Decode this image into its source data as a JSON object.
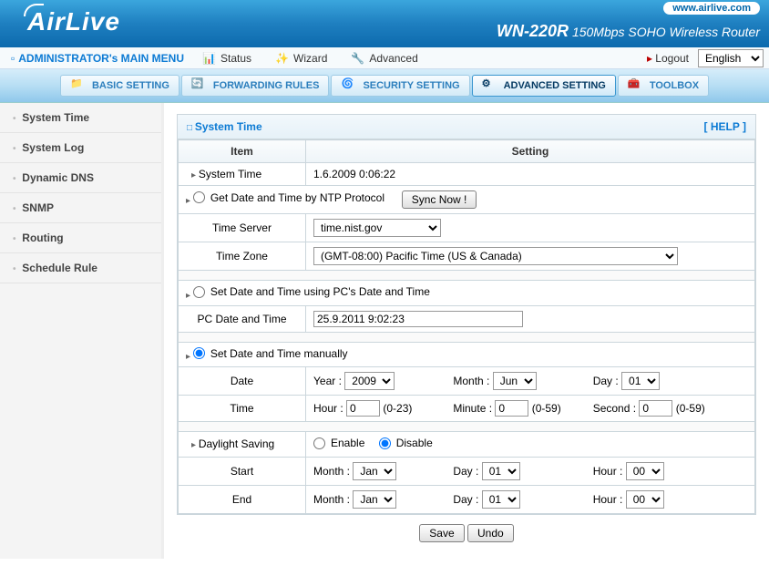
{
  "header": {
    "brand": "AirLive",
    "url_pill": "www.airlive.com",
    "model": "WN-220R",
    "tagline": "150Mbps SOHO Wireless Router"
  },
  "menubar": {
    "admin": "ADMINISTRATOR's MAIN MENU",
    "items": [
      "Status",
      "Wizard",
      "Advanced"
    ],
    "logout": "Logout",
    "language": "English"
  },
  "tabs": [
    "BASIC SETTING",
    "FORWARDING RULES",
    "SECURITY SETTING",
    "ADVANCED SETTING",
    "TOOLBOX"
  ],
  "sidebar": {
    "items": [
      "System Time",
      "System Log",
      "Dynamic DNS",
      "SNMP",
      "Routing",
      "Schedule Rule"
    ]
  },
  "panel": {
    "title": "System Time",
    "help": "[ HELP ]",
    "col_item": "Item",
    "col_setting": "Setting",
    "system_time_lbl": "System Time",
    "system_time_val": "1.6.2009 0:06:22",
    "ntp": {
      "label": "Get Date and Time by NTP Protocol",
      "sync_btn": "Sync Now !",
      "time_server_lbl": "Time Server",
      "time_server_val": "time.nist.gov",
      "time_zone_lbl": "Time Zone",
      "time_zone_val": "(GMT-08:00) Pacific Time (US & Canada)"
    },
    "pc": {
      "label": "Set Date and Time using PC's Date and Time",
      "pc_dt_lbl": "PC Date and Time",
      "pc_dt_val": "25.9.2011 9:02:23"
    },
    "manual": {
      "label": "Set Date and Time manually",
      "date_lbl": "Date",
      "time_lbl": "Time",
      "year_lbl": "Year :",
      "year_val": "2009",
      "month_lbl": "Month :",
      "month_val": "Jun",
      "day_lbl": "Day :",
      "day_val": "01",
      "hour_lbl": "Hour :",
      "hour_val": "0",
      "hour_range": "(0-23)",
      "minute_lbl": "Minute :",
      "minute_val": "0",
      "minute_range": "(0-59)",
      "second_lbl": "Second :",
      "second_val": "0",
      "second_range": "(0-59)"
    },
    "dst": {
      "label": "Daylight Saving",
      "enable": "Enable",
      "disable": "Disable",
      "start_lbl": "Start",
      "end_lbl": "End",
      "m_lbl": "Month :",
      "d_lbl": "Day :",
      "h_lbl": "Hour :",
      "start_m": "Jan",
      "start_d": "01",
      "start_h": "00",
      "end_m": "Jan",
      "end_d": "01",
      "end_h": "00"
    },
    "save": "Save",
    "undo": "Undo"
  }
}
